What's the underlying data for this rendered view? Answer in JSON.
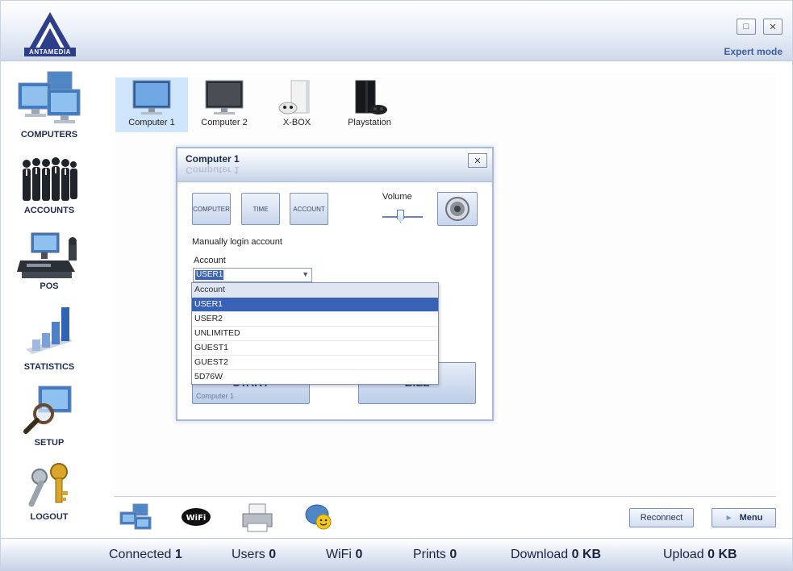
{
  "header": {
    "logo_text": "ANTAMEDIA",
    "minimize_icon": "minimize-icon",
    "close_icon": "close-icon",
    "expert_mode": "Expert mode"
  },
  "sidebar": {
    "items": [
      {
        "label": "COMPUTERS",
        "icon": "computers-icon"
      },
      {
        "label": "ACCOUNTS",
        "icon": "accounts-icon"
      },
      {
        "label": "POS",
        "icon": "pos-icon"
      },
      {
        "label": "STATISTICS",
        "icon": "statistics-icon"
      },
      {
        "label": "SETUP",
        "icon": "setup-icon"
      },
      {
        "label": "LOGOUT",
        "icon": "logout-icon"
      }
    ]
  },
  "devices": [
    {
      "label": "Computer 1",
      "selected": true
    },
    {
      "label": "Computer 2",
      "selected": false
    },
    {
      "label": "X-BOX",
      "selected": false
    },
    {
      "label": "Playstation",
      "selected": false
    }
  ],
  "dialog": {
    "title": "Computer 1",
    "tabs": [
      "COMPUTER",
      "TIME",
      "ACCOUNT"
    ],
    "volume_label": "Volume",
    "volume_level": 0.45,
    "manual_login_label": "Manually login account",
    "account_label": "Account",
    "account_value": "USER1",
    "start_button": "START",
    "start_subtext": "Computer 1",
    "bill_button": "BILL"
  },
  "dropdown": {
    "header": "Account",
    "options": [
      "USER1",
      "USER2",
      "UNLIMITED",
      "GUEST1",
      "GUEST2",
      "5D76W"
    ],
    "selected": "USER1"
  },
  "toolbar": {
    "icons": [
      "network-icon",
      "wifi-icon",
      "printer-icon",
      "chat-icon"
    ],
    "reconnect_label": "Reconnect",
    "menu_label": "Menu"
  },
  "status": {
    "connected_label": "Connected",
    "connected_value": "1",
    "users_label": "Users",
    "users_value": "0",
    "wifi_label": "WiFi",
    "wifi_value": "0",
    "prints_label": "Prints",
    "prints_value": "0",
    "download_label": "Download",
    "download_value": "0 KB",
    "upload_label": "Upload",
    "upload_value": "0 KB"
  },
  "colors": {
    "accent": "#3862b6",
    "header_gradient_end": "#cfd9ea",
    "selected_device": "#cfe5fb"
  }
}
